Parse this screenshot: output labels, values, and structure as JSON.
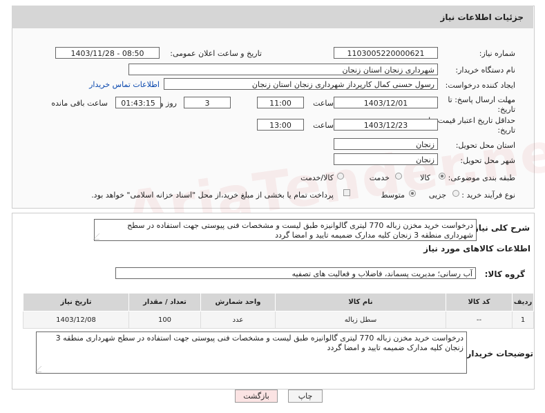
{
  "header": {
    "title": "جزئیات اطلاعات نیاز"
  },
  "fields": {
    "need_number_label": "شماره نیاز:",
    "need_number": "1103005220000621",
    "announce_label": "تاریخ و ساعت اعلان عمومی:",
    "announce_value": "1403/11/28 - 08:50",
    "buyer_label": "نام دستگاه خریدار:",
    "buyer_value": "شهرداری زنجان استان زنجان",
    "creator_label": "ایجاد کننده درخواست:",
    "creator_value": "رسول حسنی کمال کارپرداز شهرداری زنجان استان زنجان",
    "contact_link": "اطلاعات تماس خریدار",
    "deadline_label": "مهلت ارسال پاسخ: تا تاریخ:",
    "deadline_date": "1403/12/01",
    "time_word": "ساعت",
    "deadline_time": "11:00",
    "days_value": "3",
    "days_word": "روز و",
    "remaining_time": "01:43:15",
    "remaining_word": "ساعت باقی مانده",
    "validity_label": "حداقل تاریخ اعتبار قیمت: تا تاریخ:",
    "validity_date": "1403/12/23",
    "validity_time": "13:00",
    "province_label": "استان محل تحویل:",
    "province_value": "زنجان",
    "city_label": "شهر محل تحویل:",
    "city_value": "زنجان",
    "category_label": "طبقه بندی موضوعی:",
    "category_options": [
      "کالا",
      "خدمت",
      "کالا/خدمت"
    ],
    "process_label": "نوع فرآیند خرید :",
    "process_options": [
      "جزیی",
      "متوسط"
    ],
    "payment_note": "پرداخت تمام یا بخشی از مبلغ خرید،از محل \"اسناد خزانه اسلامی\" خواهد بود."
  },
  "description": {
    "label": "شرح کلی نیاز:",
    "text": "درخواست خرید مخزن زباله 770 لیتری گالوانیزه طبق لیست و مشخصات فنی پیوستی جهت استفاده در سطح شهرداری منطقه 3 زنجان کلیه مدارک ضمیمه تایید و امضا گردد"
  },
  "goods": {
    "section_title": "اطلاعات کالاهای مورد نیاز",
    "group_label": "گروه کالا:",
    "group_value": "آب رسانی؛ مدیریت پسماند، فاضلاب و فعالیت های تصفیه",
    "columns": [
      "ردیف",
      "کد کالا",
      "نام کالا",
      "واحد شمارش",
      "تعداد / مقدار",
      "تاریخ نیاز"
    ],
    "rows": [
      [
        "1",
        "--",
        "سطل زباله",
        "عدد",
        "100",
        "1403/12/08"
      ]
    ]
  },
  "buyer_notes": {
    "label": "توضیحات خریدار:",
    "text": "درخواست خرید مخزن زباله 770 لیتری گالوانیزه طبق لیست و مشخصات فنی پیوستی جهت استفاده در سطح شهرداری منطقه 3 زنجان کلیه مدارک ضمیمه تایید و امضا گردد"
  },
  "buttons": {
    "print": "چاپ",
    "back": "بازگشت"
  },
  "watermark": "AriaTender.neT"
}
